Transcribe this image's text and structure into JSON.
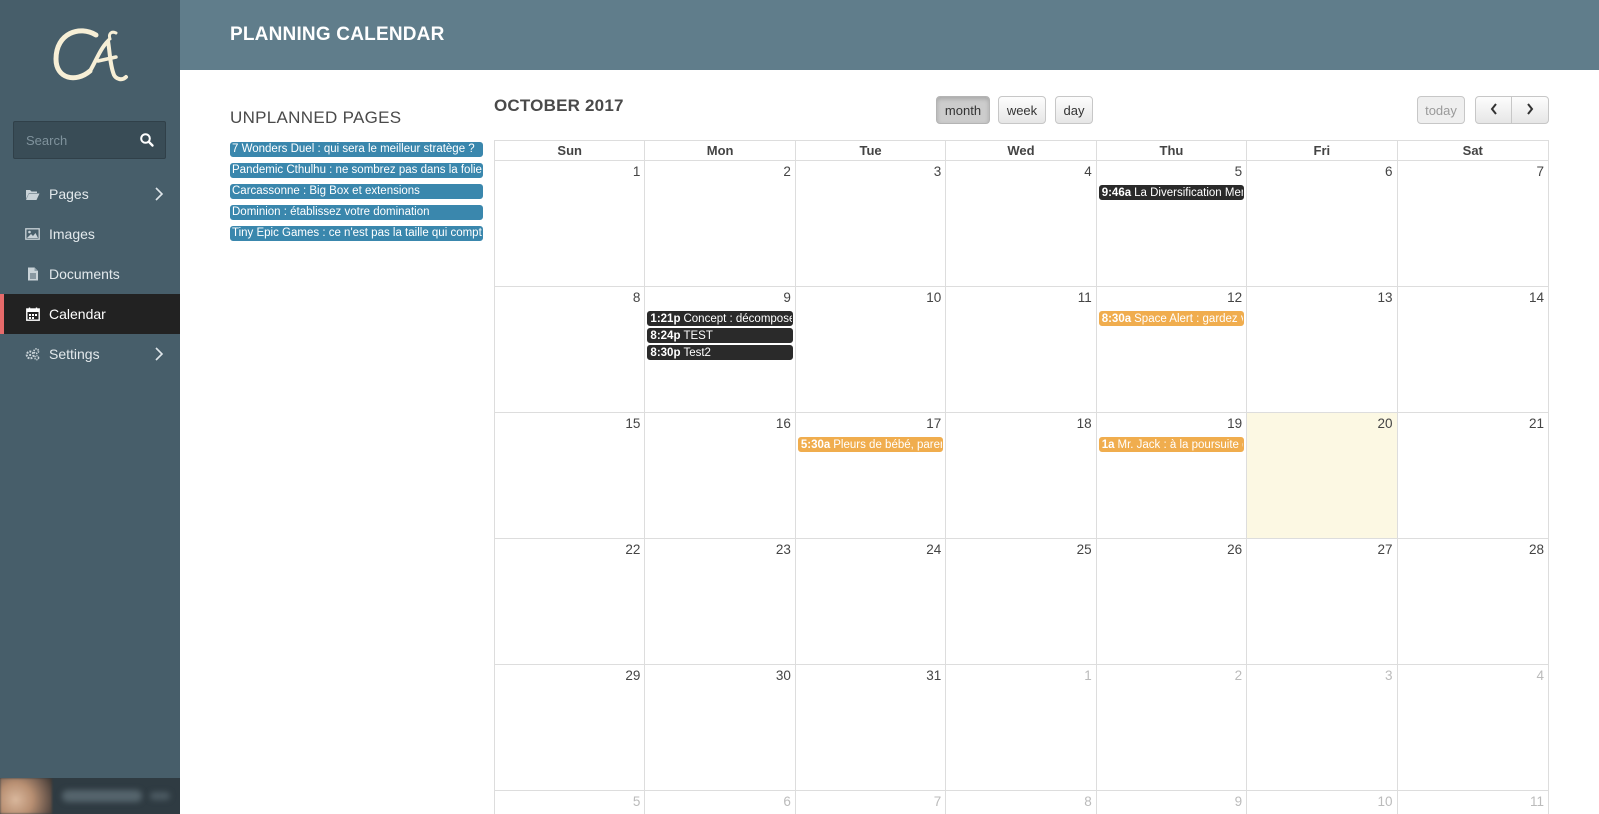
{
  "sidebar": {
    "logo_text": "Ca",
    "search_placeholder": "Search",
    "nav": [
      {
        "label": "Pages",
        "icon": "folder-open-icon",
        "has_children": true
      },
      {
        "label": "Images",
        "icon": "image-icon",
        "has_children": false
      },
      {
        "label": "Documents",
        "icon": "document-icon",
        "has_children": false
      },
      {
        "label": "Calendar",
        "icon": "calendar-icon",
        "has_children": false,
        "active": true
      },
      {
        "label": "Settings",
        "icon": "gears-icon",
        "has_children": true
      }
    ]
  },
  "header": {
    "title": "PLANNING CALENDAR"
  },
  "unplanned": {
    "title": "UNPLANNED PAGES",
    "items": [
      "7 Wonders Duel : qui sera le meilleur stratège ?",
      "Pandemic Cthulhu : ne sombrez pas dans la folie !",
      "Carcassonne : Big Box et extensions",
      "Dominion : établissez votre domination",
      "Tiny Epic Games : ce n'est pas la taille qui compte"
    ]
  },
  "calendar": {
    "title": "OCTOBER 2017",
    "views": {
      "month": "month",
      "week": "week",
      "day": "day"
    },
    "active_view": "month",
    "today_label": "today",
    "prev_label": "‹",
    "next_label": "›",
    "weekdays": [
      "Sun",
      "Mon",
      "Tue",
      "Wed",
      "Thu",
      "Fri",
      "Sat"
    ],
    "weeks": [
      [
        {
          "d": "1"
        },
        {
          "d": "2"
        },
        {
          "d": "3"
        },
        {
          "d": "4"
        },
        {
          "d": "5"
        },
        {
          "d": "6"
        },
        {
          "d": "7"
        }
      ],
      [
        {
          "d": "8"
        },
        {
          "d": "9"
        },
        {
          "d": "10"
        },
        {
          "d": "11"
        },
        {
          "d": "12"
        },
        {
          "d": "13"
        },
        {
          "d": "14"
        }
      ],
      [
        {
          "d": "15"
        },
        {
          "d": "16"
        },
        {
          "d": "17"
        },
        {
          "d": "18"
        },
        {
          "d": "19"
        },
        {
          "d": "20",
          "today": true
        },
        {
          "d": "21"
        }
      ],
      [
        {
          "d": "22"
        },
        {
          "d": "23"
        },
        {
          "d": "24"
        },
        {
          "d": "25"
        },
        {
          "d": "26"
        },
        {
          "d": "27"
        },
        {
          "d": "28"
        }
      ],
      [
        {
          "d": "29"
        },
        {
          "d": "30"
        },
        {
          "d": "31"
        },
        {
          "d": "1",
          "other": true
        },
        {
          "d": "2",
          "other": true
        },
        {
          "d": "3",
          "other": true
        },
        {
          "d": "4",
          "other": true
        }
      ],
      [
        {
          "d": "5",
          "other": true
        },
        {
          "d": "6",
          "other": true
        },
        {
          "d": "7",
          "other": true
        },
        {
          "d": "8",
          "other": true
        },
        {
          "d": "9",
          "other": true
        },
        {
          "d": "10",
          "other": true
        },
        {
          "d": "11",
          "other": true
        }
      ]
    ],
    "events": [
      {
        "week": 0,
        "day": 4,
        "time": "9:46a",
        "title": "La Diversification Men",
        "color": "dark"
      },
      {
        "week": 1,
        "day": 1,
        "time": "1:21p",
        "title": "Concept : décompose",
        "color": "dark"
      },
      {
        "week": 1,
        "day": 1,
        "time": "8:24p",
        "title": "TEST",
        "color": "dark"
      },
      {
        "week": 1,
        "day": 1,
        "time": "8:30p",
        "title": "Test2",
        "color": "dark"
      },
      {
        "week": 1,
        "day": 4,
        "time": "8:30a",
        "title": "Space Alert : gardez vo",
        "color": "orange"
      },
      {
        "week": 2,
        "day": 2,
        "time": "5:30a",
        "title": "Pleurs de bébé, paren",
        "color": "orange"
      },
      {
        "week": 2,
        "day": 4,
        "time": "1a",
        "title": "Mr. Jack : à la poursuite d",
        "color": "orange"
      }
    ]
  },
  "colors": {
    "sidebar_bg": "#475e6a",
    "header_bg": "#607d8b",
    "active_accent": "#e76b6b",
    "unplanned_event": "#3a87ad",
    "event_dark": "#2a2a2a",
    "event_orange": "#f0ad4e",
    "today_bg": "#fcf8e3"
  }
}
